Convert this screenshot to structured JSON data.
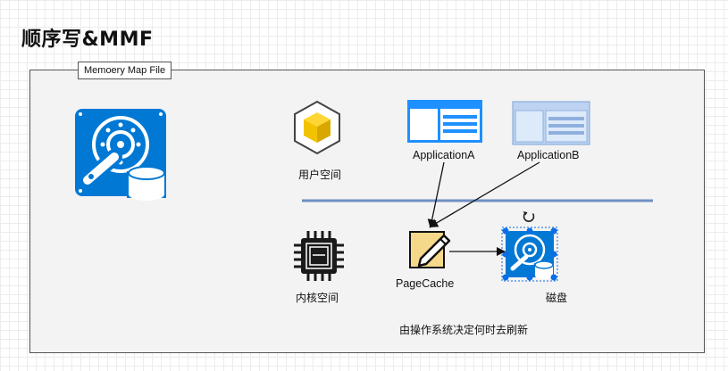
{
  "title": "顺序写&MMF",
  "frame_label": "Memoery Map File",
  "labels": {
    "user_space": "用户空间",
    "app_a": "ApplicationA",
    "app_b": "ApplicationB",
    "kernel_space": "内核空间",
    "page_cache": "PageCache",
    "disk": "磁盘",
    "note": "由操作系统决定何时去刷新"
  },
  "colors": {
    "disk_blue": "#0078d4",
    "divider": "#6f8fc4",
    "app_a_blue": "#1e90ff",
    "app_b_blue": "#b3cdf0",
    "cube_yellow": "#f2c200",
    "handle_blue": "#0a6ee6"
  },
  "icons": {
    "large_disk": "hard-drive-icon",
    "user_space": "cube-icon",
    "app_a": "window-icon",
    "app_b": "window-icon",
    "kernel": "cpu-chip-icon",
    "page_cache": "note-pencil-icon",
    "disk": "hard-drive-icon",
    "rotate": "rotate-icon"
  }
}
